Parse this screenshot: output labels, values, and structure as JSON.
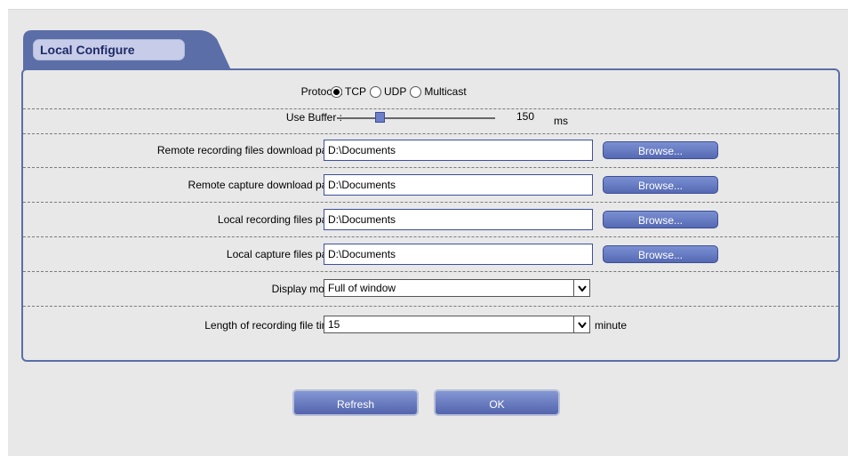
{
  "tab": {
    "title": "Local Configure"
  },
  "protocol": {
    "label": "Protocol:",
    "options": [
      "TCP",
      "UDP",
      "Multicast"
    ],
    "selected": "TCP"
  },
  "buffer": {
    "label": "Use Buffer :",
    "value": "150",
    "unit": "ms",
    "level": 0.24
  },
  "paths": [
    {
      "label": "Remote recording files download path :",
      "value": "D:\\Documents",
      "button": "Browse..."
    },
    {
      "label": "Remote capture download path :",
      "value": "D:\\Documents",
      "button": "Browse..."
    },
    {
      "label": "Local recording files path :",
      "value": "D:\\Documents",
      "button": "Browse..."
    },
    {
      "label": "Local capture files path :",
      "value": "D:\\Documents",
      "button": "Browse..."
    }
  ],
  "display_mode": {
    "label": "Display mode :",
    "value": "Full of window"
  },
  "record_length": {
    "label": "Length of recording file time :",
    "value": "15",
    "unit": "minute"
  },
  "actions": {
    "refresh": "Refresh",
    "ok": "OK"
  },
  "colors": {
    "accent": "#5b6ea8",
    "button": "#6072bd",
    "tab": "#c7cde9"
  }
}
